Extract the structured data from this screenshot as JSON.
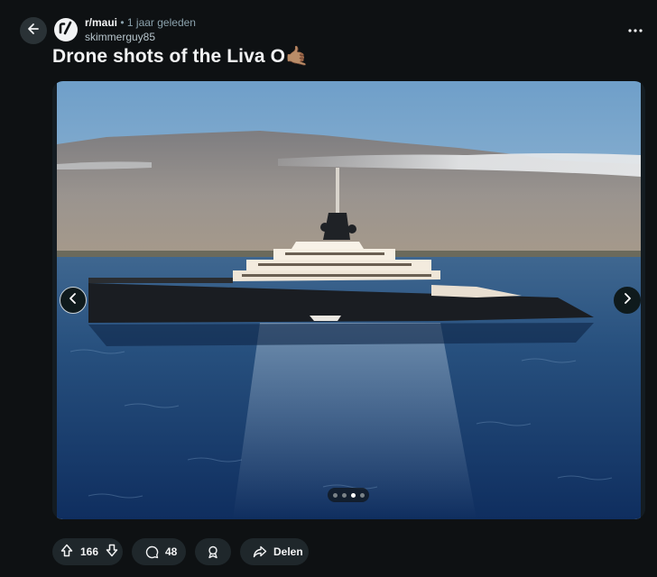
{
  "post": {
    "subreddit": "r/maui",
    "separator": "•",
    "time_ago": "1 jaar geleden",
    "author": "skimmerguy85",
    "title": "Drone shots of the Liva O🤙🏽"
  },
  "gallery": {
    "total_slides": 4,
    "active_slide": 3
  },
  "actions": {
    "upvotes": "166",
    "comments": "48",
    "share_label": "Delen"
  },
  "icons": [
    "back-arrow-icon",
    "subreddit-icon",
    "more-options-icon",
    "chevron-left-icon",
    "chevron-right-icon",
    "upvote-icon",
    "downvote-icon",
    "comment-icon",
    "award-icon",
    "share-icon"
  ],
  "colors": {
    "background": "#0e1113",
    "pill": "#1f272b",
    "muted_text": "#8ba2ad"
  }
}
